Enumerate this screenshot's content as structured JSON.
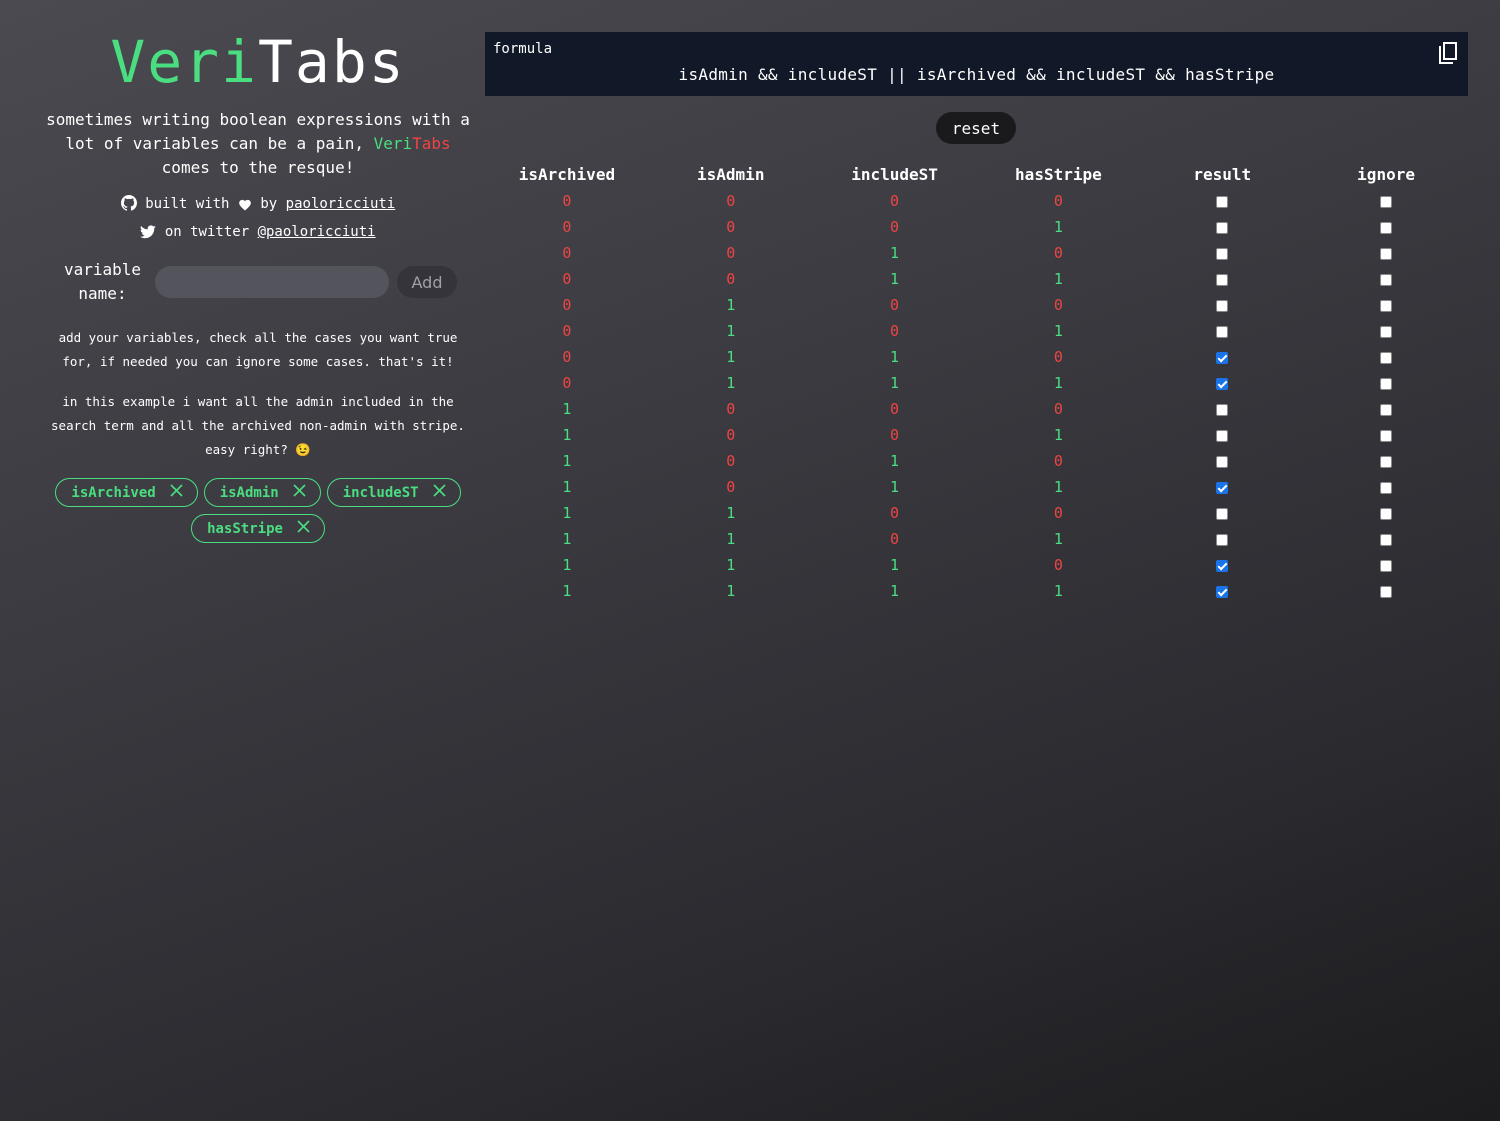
{
  "app": {
    "logo_part1": "Veri",
    "logo_part2": "Tabs",
    "tagline_pre": "sometimes writing boolean expressions with a lot of variables can be a pain, ",
    "tagline_brand1": "Veri",
    "tagline_brand2": "Tabs",
    "tagline_post": " comes to the resque!",
    "credit_built": "built with",
    "credit_by": "by",
    "credit_author": "paoloricciuti",
    "credit_twitter": "on twitter",
    "credit_twitter_handle": "@paoloricciuti"
  },
  "form": {
    "label": "variable name:",
    "input_value": "",
    "input_placeholder": "",
    "add_label": "Add"
  },
  "help": {
    "p1": "add your variables, check all the cases you want true for, if needed you can ignore some cases. that's it!",
    "p2": "in this example i want all the admin included in the search term and all the archived non-admin with stripe. easy right? 😉"
  },
  "variables": [
    "isArchived",
    "isAdmin",
    "includeST",
    "hasStripe"
  ],
  "formula": {
    "label": "formula",
    "text": "isAdmin && includeST || isArchived && includeST && hasStripe"
  },
  "reset_label": "reset",
  "table": {
    "headers": [
      "isArchived",
      "isAdmin",
      "includeST",
      "hasStripe",
      "result",
      "ignore"
    ],
    "rows": [
      [
        0,
        0,
        0,
        0
      ],
      [
        0,
        0,
        0,
        1
      ],
      [
        0,
        0,
        1,
        0
      ],
      [
        0,
        0,
        1,
        1
      ],
      [
        0,
        1,
        0,
        0
      ],
      [
        0,
        1,
        0,
        1
      ],
      [
        0,
        1,
        1,
        0
      ],
      [
        0,
        1,
        1,
        1
      ],
      [
        1,
        0,
        0,
        0
      ],
      [
        1,
        0,
        0,
        1
      ],
      [
        1,
        0,
        1,
        0
      ],
      [
        1,
        0,
        1,
        1
      ],
      [
        1,
        1,
        0,
        0
      ],
      [
        1,
        1,
        0,
        1
      ],
      [
        1,
        1,
        1,
        0
      ],
      [
        1,
        1,
        1,
        1
      ]
    ],
    "result": [
      false,
      false,
      false,
      false,
      false,
      false,
      true,
      true,
      false,
      false,
      false,
      true,
      false,
      false,
      true,
      true
    ],
    "ignore": [
      false,
      false,
      false,
      false,
      false,
      false,
      false,
      false,
      false,
      false,
      false,
      false,
      false,
      false,
      false,
      false
    ]
  },
  "colors": {
    "true": "#4ade80",
    "false": "#ef4444",
    "checkbox_on": "#1a73e8"
  },
  "icons": {
    "github": "github-icon",
    "heart": "heart-icon",
    "twitter": "twitter-icon",
    "copy": "copy-icon",
    "remove": "close-icon"
  }
}
